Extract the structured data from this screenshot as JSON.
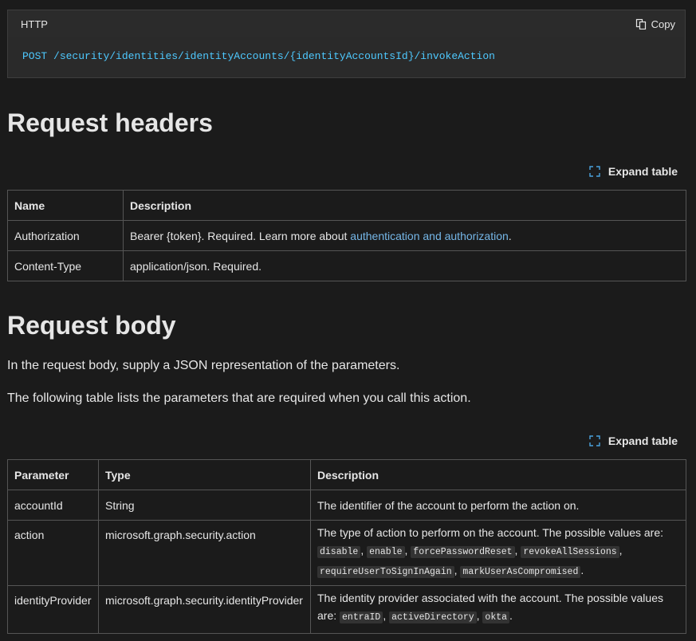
{
  "code": {
    "language": "HTTP",
    "copy_label": "Copy",
    "method": "POST",
    "path": "/security/identities/identityAccounts/{identityAccountsId}/invokeAction"
  },
  "headers_section": {
    "title": "Request headers",
    "expand_label": "Expand table",
    "columns": [
      "Name",
      "Description"
    ],
    "rows": [
      {
        "name": "Authorization",
        "desc_pre": "Bearer {token}. Required. Learn more about ",
        "link": "authentication and authorization",
        "desc_post": "."
      },
      {
        "name": "Content-Type",
        "desc": "application/json. Required."
      }
    ]
  },
  "body_section": {
    "title": "Request body",
    "intro": "In the request body, supply a JSON representation of the parameters.",
    "intro2": "The following table lists the parameters that are required when you call this action.",
    "expand_label": "Expand table",
    "columns": [
      "Parameter",
      "Type",
      "Description"
    ],
    "rows": [
      {
        "param": "accountId",
        "type": "String",
        "desc": "The identifier of the account to perform the action on."
      },
      {
        "param": "action",
        "type": "microsoft.graph.security.action",
        "desc": "The type of action to perform on the account. The possible values are:",
        "values": [
          "disable",
          "enable",
          "forcePasswordReset",
          "revokeAllSessions",
          "requireUserToSignInAgain",
          "markUserAsCompromised"
        ]
      },
      {
        "param": "identityProvider",
        "type": "microsoft.graph.security.identityProvider",
        "desc": "The identity provider associated with the account. The possible values are:",
        "values": [
          "entraID",
          "activeDirectory",
          "okta"
        ]
      }
    ]
  }
}
